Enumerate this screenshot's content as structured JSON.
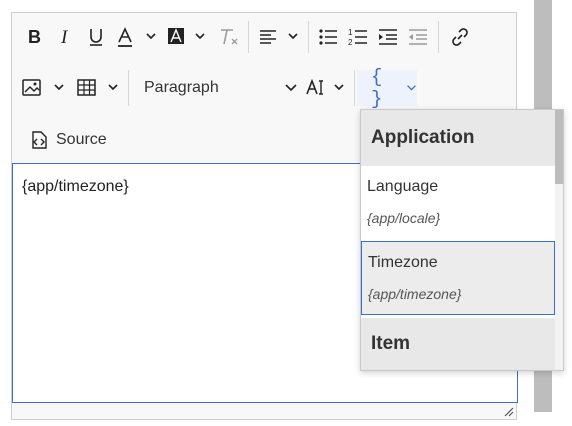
{
  "toolbar": {
    "paragraph_label": "Paragraph",
    "source_label": "Source",
    "insert_expression_label": "{ }"
  },
  "content": {
    "text": "{app/timezone}"
  },
  "menu": {
    "group_application": "Application",
    "group_item": "Item",
    "items": [
      {
        "name": "Language",
        "expression": "{app/locale}"
      },
      {
        "name": "Timezone",
        "expression": "{app/timezone}"
      }
    ]
  },
  "colors": {
    "accent": "#3b6fcf",
    "menu_header_bg": "#e8e8e8",
    "scrollbar": "#bdbdbd"
  }
}
